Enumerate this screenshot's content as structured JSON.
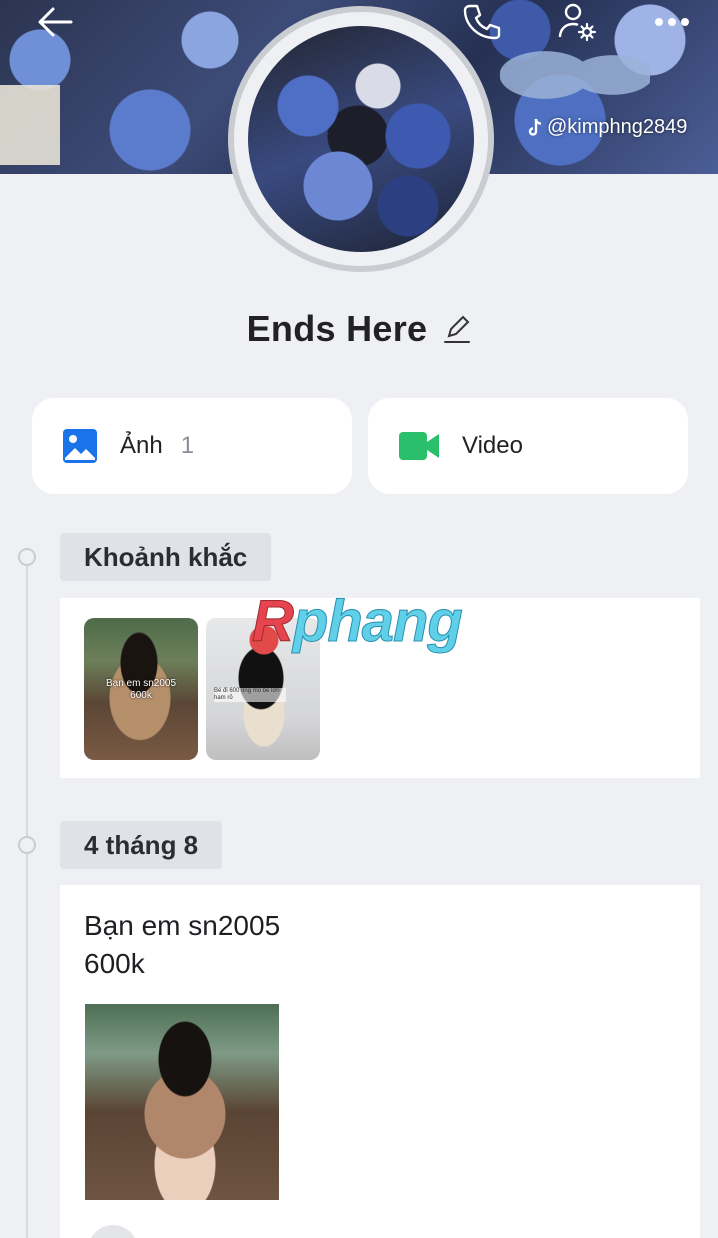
{
  "cover": {
    "tiktok_handle": "@kimphng2849"
  },
  "profile": {
    "name": "Ends Here"
  },
  "media": {
    "photo_label": "Ảnh",
    "photo_count": "1",
    "video_label": "Video"
  },
  "timeline": [
    {
      "label": "Khoảnh khắc",
      "thumb1_caption": "Bạn em sn2005\n600k",
      "thumb2_caption": "Bé đi 600 ông mỏ bé lớn ham rõ"
    },
    {
      "label": "4 tháng 8",
      "post_text": "Bạn em sn2005\n600k"
    }
  ],
  "watermark": {
    "first": "R",
    "rest": "phang"
  },
  "colors": {
    "background": "#eef0f4",
    "photo_icon": "#1a73e8",
    "video_icon": "#2ac06b"
  }
}
